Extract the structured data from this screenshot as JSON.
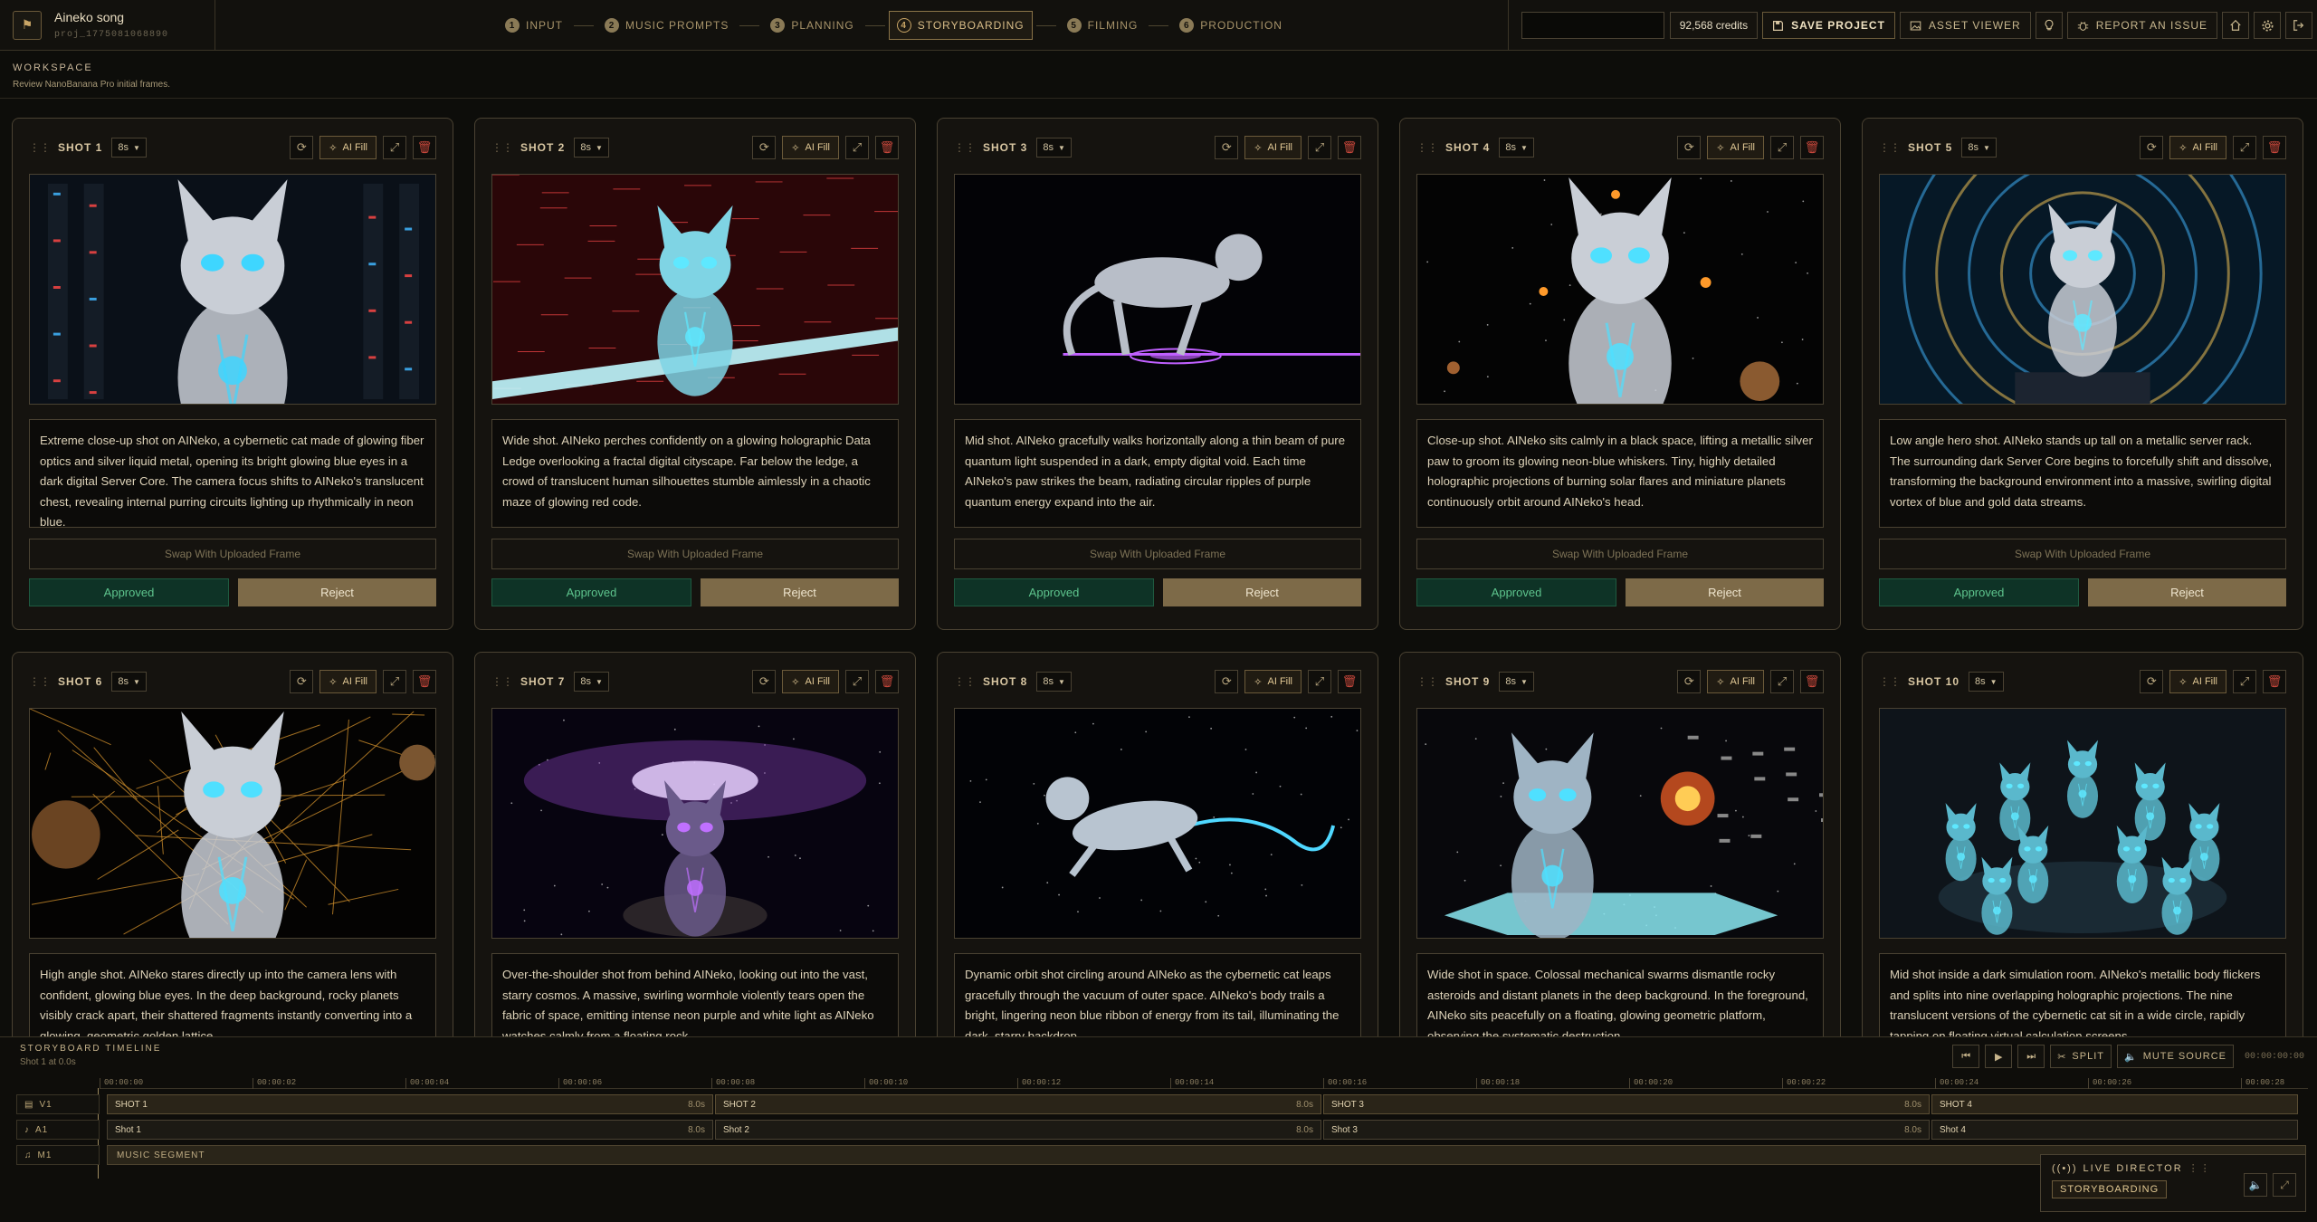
{
  "app": {
    "logo_glyph": "⚑",
    "project_title": "Aineko song",
    "project_id": "proj_1775081068890"
  },
  "steps": [
    {
      "num": "1",
      "label": "INPUT"
    },
    {
      "num": "2",
      "label": "MUSIC PROMPTS"
    },
    {
      "num": "3",
      "label": "PLANNING"
    },
    {
      "num": "4",
      "label": "STORYBOARDING"
    },
    {
      "num": "5",
      "label": "FILMING"
    },
    {
      "num": "6",
      "label": "PRODUCTION"
    }
  ],
  "active_step": "STORYBOARDING",
  "toolbar": {
    "credits": "92,568 credits",
    "save_label": "SAVE PROJECT",
    "asset_viewer_label": "ASSET VIEWER",
    "report_label": "REPORT AN ISSUE"
  },
  "workspace": {
    "heading": "WORKSPACE",
    "subtitle": "Review NanoBanana Pro initial frames."
  },
  "card_labels": {
    "ai_fill": "AI Fill",
    "swap": "Swap With Uploaded Frame",
    "approved": "Approved",
    "reject": "Reject"
  },
  "shots": [
    {
      "label": "SHOT 1",
      "duration": "8s",
      "scene": "closeup-cat-server",
      "description": "Extreme close-up shot on AINeko, a cybernetic cat made of glowing fiber optics and silver liquid metal, opening its bright glowing blue eyes in a dark digital Server Core. The camera focus shifts to AINeko's translucent chest, revealing internal purring circuits lighting up rhythmically in neon blue."
    },
    {
      "label": "SHOT 2",
      "duration": "8s",
      "scene": "cat-data-ledge-red-city",
      "description": "Wide shot. AINeko perches confidently on a glowing holographic Data Ledge overlooking a fractal digital cityscape. Far below the ledge, a crowd of translucent human silhouettes stumble aimlessly in a chaotic maze of glowing red code."
    },
    {
      "label": "SHOT 3",
      "duration": "8s",
      "scene": "cat-walking-beam",
      "description": "Mid shot. AINeko gracefully walks horizontally along a thin beam of pure quantum light suspended in a dark, empty digital void. Each time AINeko's paw strikes the beam, radiating circular ripples of purple quantum energy expand into the air."
    },
    {
      "label": "SHOT 4",
      "duration": "8s",
      "scene": "cat-grooming-planets",
      "description": "Close-up shot. AINeko sits calmly in a black space, lifting a metallic silver paw to groom its glowing neon-blue whiskers. Tiny, highly detailed holographic projections of burning solar flares and miniature planets continuously orbit around AINeko's head."
    },
    {
      "label": "SHOT 5",
      "duration": "8s",
      "scene": "cat-vortex",
      "description": "Low angle hero shot. AINeko stands up tall on a metallic server rack. The surrounding dark Server Core begins to forcefully shift and dissolve, transforming the background environment into a massive, swirling digital vortex of blue and gold data streams."
    },
    {
      "label": "SHOT 6",
      "duration": "8s",
      "scene": "cat-golden-lattice",
      "description": "High angle shot. AINeko stares directly up into the camera lens with confident, glowing blue eyes. In the deep background, rocky planets visibly crack apart, their shattered fragments instantly converting into a glowing, geometric golden lattice."
    },
    {
      "label": "SHOT 7",
      "duration": "8s",
      "scene": "cat-wormhole",
      "description": "Over-the-shoulder shot from behind AINeko, looking out into the vast, starry cosmos. A massive, swirling wormhole violently tears open the fabric of space, emitting intense neon purple and white light as AINeko watches calmly from a floating rock."
    },
    {
      "label": "SHOT 8",
      "duration": "8s",
      "scene": "cat-leaping-space",
      "description": "Dynamic orbit shot circling around AINeko as the cybernetic cat leaps gracefully through the vacuum of outer space. AINeko's body trails a bright, lingering neon blue ribbon of energy from its tail, illuminating the dark, starry backdrop."
    },
    {
      "label": "SHOT 9",
      "duration": "8s",
      "scene": "cat-platform-swarms",
      "description": "Wide shot in space. Colossal mechanical swarms dismantle rocky asteroids and distant planets in the deep background. In the foreground, AINeko sits peacefully on a floating, glowing geometric platform, observing the systematic destruction."
    },
    {
      "label": "SHOT 10",
      "duration": "8s",
      "scene": "nine-cats-room",
      "description": "Mid shot inside a dark simulation room. AINeko's metallic body flickers and splits into nine overlapping holographic projections. The nine translucent versions of the cybernetic cat sit in a wide circle, rapidly tapping on floating virtual calculation screens."
    }
  ],
  "timeline": {
    "heading": "STORYBOARD TIMELINE",
    "status": "Shot 1 at 0.0s",
    "split_label": "SPLIT",
    "mute_label": "MUTE SOURCE",
    "timecode": "00:00:00:00",
    "ruler": [
      "00:00:00",
      "00:00:02",
      "00:00:04",
      "00:00:06",
      "00:00:08",
      "00:00:10",
      "00:00:12",
      "00:00:14",
      "00:00:16",
      "00:00:18",
      "00:00:20",
      "00:00:22",
      "00:00:24",
      "00:00:26",
      "00:00:28"
    ],
    "tracks": {
      "v1": "V1",
      "a1": "A1",
      "m1": "M1"
    },
    "video_clips": [
      {
        "label": "SHOT 1",
        "dur": "8.0s"
      },
      {
        "label": "SHOT 2",
        "dur": "8.0s"
      },
      {
        "label": "SHOT 3",
        "dur": "8.0s"
      },
      {
        "label": "SHOT 4",
        "dur": ""
      }
    ],
    "audio_clips": [
      {
        "label": "Shot 1",
        "dur": "8.0s"
      },
      {
        "label": "Shot 2",
        "dur": "8.0s"
      },
      {
        "label": "Shot 3",
        "dur": "8.0s"
      },
      {
        "label": "Shot 4",
        "dur": ""
      }
    ],
    "music_label": "MUSIC SEGMENT"
  },
  "live_director": {
    "title": "LIVE DIRECTOR",
    "mode": "STORYBOARDING"
  }
}
